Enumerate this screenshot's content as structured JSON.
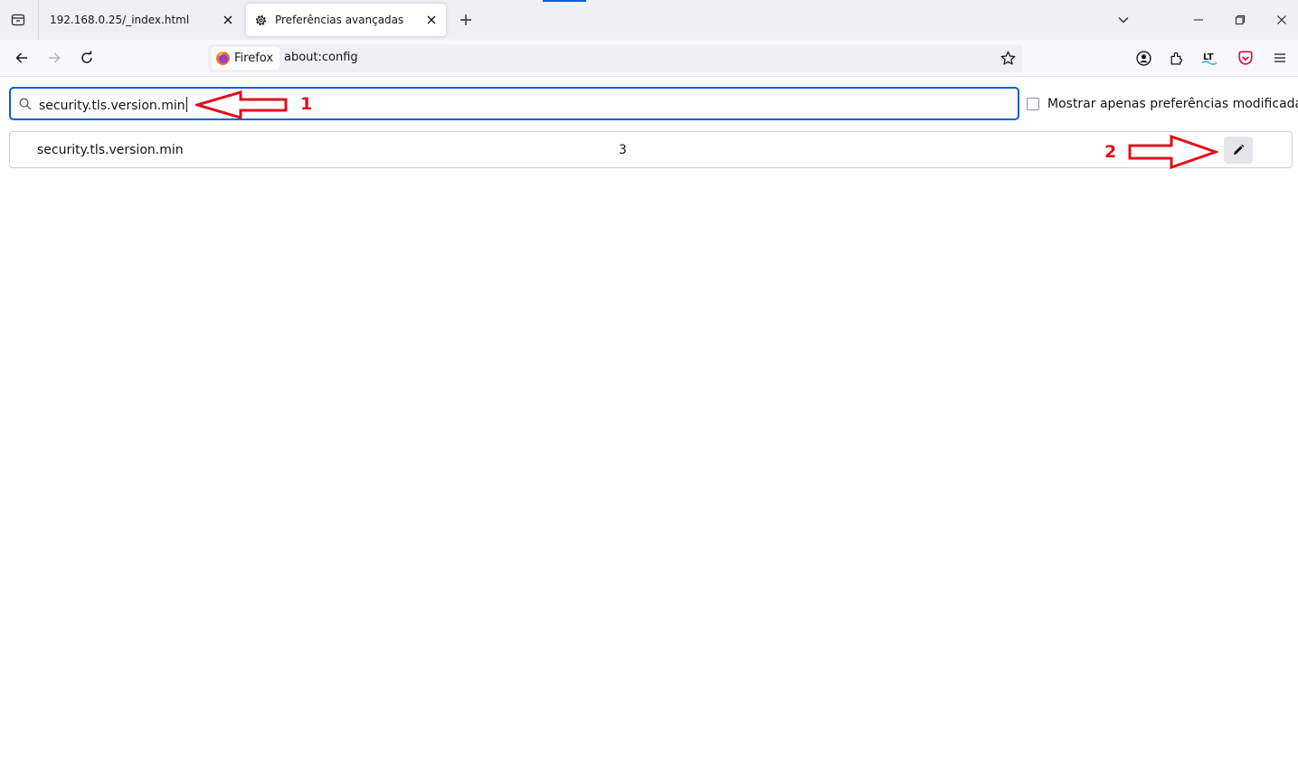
{
  "tabs": [
    {
      "title": "192.168.0.25/_index.html",
      "active": false
    },
    {
      "title": "Preferências avançadas",
      "active": true
    }
  ],
  "toolbar": {
    "identity_label": "Firefox",
    "url": "about:config"
  },
  "config": {
    "search_value": "security.tls.version.min",
    "checkbox_label": "Mostrar apenas preferências modificadas",
    "checkbox_checked": false,
    "rows": [
      {
        "name": "security.tls.version.min",
        "value": "3"
      }
    ]
  },
  "annotations": [
    {
      "label": "1",
      "target": "search-input"
    },
    {
      "label": "2",
      "target": "edit-button"
    }
  ],
  "colors": {
    "accent": "#0061e0",
    "annotation": "#e0101c",
    "tabstrip_bg": "#f0f0f4"
  },
  "icons": [
    "tab-list-icon",
    "gear-icon",
    "close-icon",
    "plus-icon",
    "chevron-down-icon",
    "minimize-icon",
    "maximize-icon",
    "window-close-icon",
    "back-arrow-icon",
    "forward-arrow-icon",
    "reload-icon",
    "firefox-logo-icon",
    "star-icon",
    "account-icon",
    "extensions-icon",
    "languagetool-icon",
    "pocket-icon",
    "menu-icon",
    "search-icon",
    "pencil-icon",
    "arrow-left-annotation",
    "arrow-right-annotation"
  ]
}
